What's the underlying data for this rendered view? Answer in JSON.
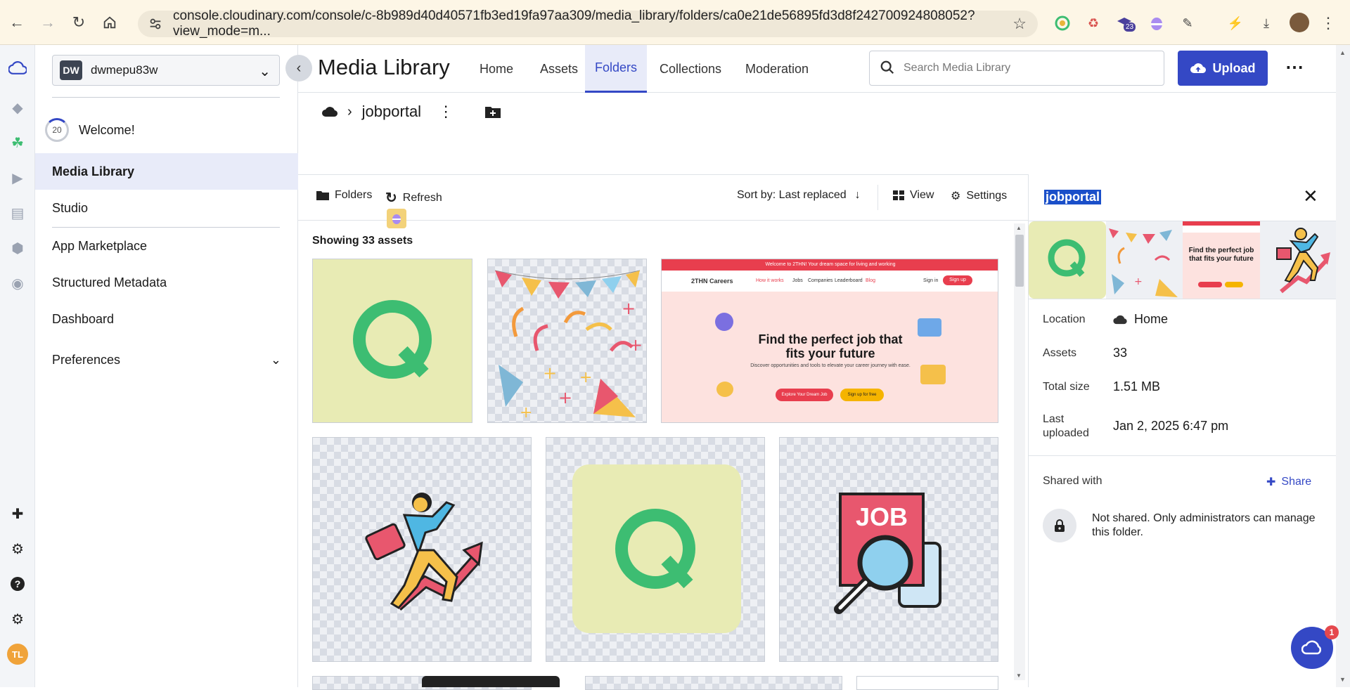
{
  "browser": {
    "url": "console.cloudinary.com/console/c-8b989d40d40571fb3ed19fa97aa309/media_library/folders/ca0e21de56895fd3d8f242700924808052?view_mode=m...",
    "extension_badge": "23"
  },
  "sidebar": {
    "account_badge": "DW",
    "account_name": "dwmepu83w",
    "welcome_count": "20",
    "welcome_label": "Welcome!",
    "items": [
      {
        "label": "Media Library"
      },
      {
        "label": "Studio"
      },
      {
        "label": "App Marketplace"
      },
      {
        "label": "Structured Metadata"
      },
      {
        "label": "Dashboard"
      },
      {
        "label": "Preferences"
      }
    ],
    "user_initials": "TL"
  },
  "header": {
    "title": "Media Library",
    "tabs": [
      {
        "label": "Home"
      },
      {
        "label": "Assets"
      },
      {
        "label": "Folders"
      },
      {
        "label": "Collections"
      },
      {
        "label": "Moderation"
      }
    ],
    "search_placeholder": "Search Media Library",
    "upload_label": "Upload"
  },
  "breadcrumb": {
    "folder": "jobportal"
  },
  "toolbar": {
    "folders_label": "Folders",
    "refresh_label": "Refresh",
    "sort_label": "Sort by: Last replaced",
    "view_label": "View",
    "settings_label": "Settings"
  },
  "content": {
    "showing": "Showing 33 assets",
    "site_banner": "Welcome to 2THN! Your dream space for living and working",
    "site_brand": "2THN Careers",
    "site_nav": [
      "How it works",
      "Jobs",
      "Companies",
      "Leaderboard",
      "Blog"
    ],
    "site_signin": "Sign in",
    "site_signup": "Sign up",
    "site_headline_1": "Find the perfect job that",
    "site_headline_2": "fits your future",
    "site_sub": "Discover opportunities and tools to elevate your career journey with ease.",
    "site_btn1": "Explore Your Dream Job",
    "site_btn2": "Sign up for free",
    "job_text": "JOB",
    "strip_headline": "Find the perfect job that fits your future"
  },
  "detail": {
    "title": "jobportal",
    "location_label": "Location",
    "location_value": "Home",
    "assets_label": "Assets",
    "assets_value": "33",
    "size_label": "Total size",
    "size_value": "1.51 MB",
    "uploaded_label_1": "Last",
    "uploaded_label_2": "uploaded",
    "uploaded_value": "Jan 2, 2025 6:47 pm",
    "shared_label": "Shared with",
    "share_label": "Share",
    "not_shared_text": "Not shared. Only administrators can manage this folder."
  },
  "chat": {
    "badge": "1"
  },
  "colors": {
    "accent": "#3448c5",
    "q_green": "#3dbd72",
    "q_bg": "#e8ebb4",
    "site_bg": "#fde2df",
    "site_red": "#e83e4e"
  }
}
